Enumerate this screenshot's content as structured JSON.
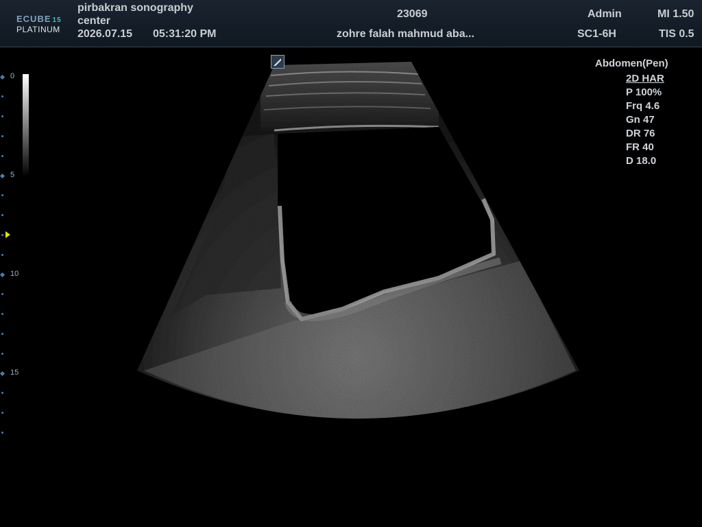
{
  "header": {
    "logo": {
      "brand": "ECUBE",
      "model_number": "15",
      "edition": "PLATINUM"
    },
    "hospital_line1": "pirbakran sonography",
    "hospital_line2": "center",
    "date": "2026.07.15",
    "time": "05:31:20  PM",
    "patient_id": "23069",
    "patient_name": "zohre falah mahmud aba...",
    "user": "Admin",
    "probe": "SC1-6H",
    "mi": "MI 1.50",
    "tis": "TIS 0.5"
  },
  "depth_scale": {
    "labels": [
      "0",
      "5",
      "10",
      "15"
    ],
    "focus_marker_color": "#e8e000"
  },
  "parameters": {
    "preset": "Abdomen(Pen)",
    "mode": "2D HAR",
    "power": "P 100%",
    "frequency": "Frq 4.6",
    "gain": "Gn 47",
    "dynamic_range": "DR 76",
    "frame_rate": "FR 40",
    "depth": "D 18.0"
  },
  "orientation_marker": {
    "icon": "orientation-marker-icon"
  },
  "colors": {
    "header_bg": "#141e28",
    "text": "#c8ced4",
    "tick": "#4a7fb0",
    "accent_logo": "#3ec4c8"
  }
}
